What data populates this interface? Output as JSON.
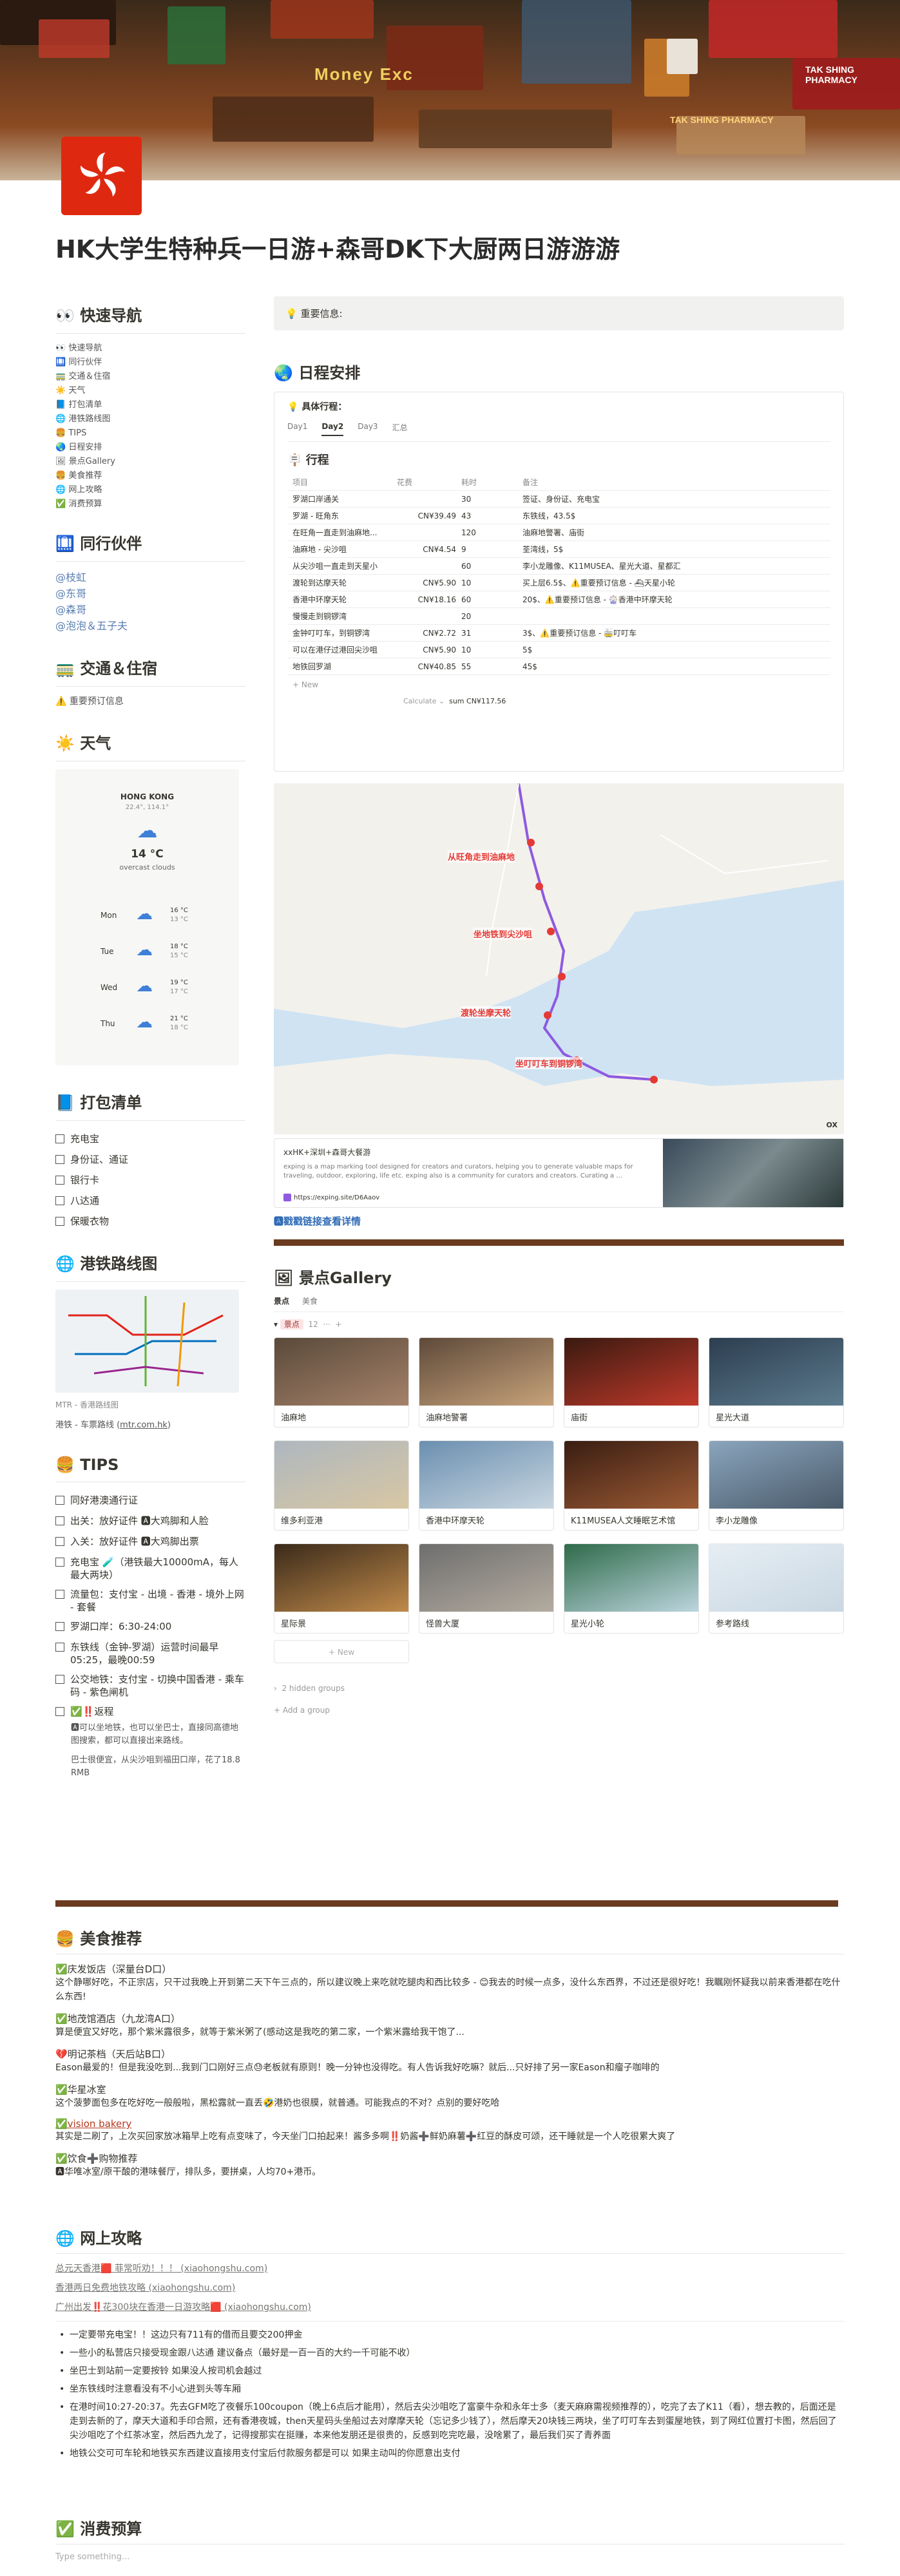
{
  "cover": {
    "signs": [
      "Money Exc",
      "TAK SHING PHARMACY",
      "TAK SHING PHARMACY"
    ]
  },
  "page": {
    "title": "HK大学生特种兵一日游+森哥DK下大厨两日游游游"
  },
  "nav": {
    "title": "快速导航",
    "items": [
      "快速导航",
      "同行伙伴",
      "交通＆住宿",
      "天气",
      "打包清单",
      "港铁路线图",
      "TIPS",
      "日程安排",
      "景点Gallery",
      "美食推荐",
      "网上攻略",
      "消费预算"
    ]
  },
  "companions": {
    "title": "同行伙伴",
    "people": [
      "@枝虹",
      "@东哥",
      "@森哥",
      "@泡泡＆五子夫"
    ]
  },
  "transport": {
    "title": "交通＆住宿",
    "item": "重要预订信息"
  },
  "weather": {
    "title": "天气",
    "city": "HONG KONG",
    "coords": "22.4°, 114.1°",
    "temp": "14 °C",
    "desc": "overcast clouds",
    "days": [
      {
        "day": "Mon",
        "hi": "16 °C",
        "lo": "13 °C"
      },
      {
        "day": "Tue",
        "hi": "18 °C",
        "lo": "15 °C"
      },
      {
        "day": "Wed",
        "hi": "19 °C",
        "lo": "17 °C"
      },
      {
        "day": "Thu",
        "hi": "21 °C",
        "lo": "18 °C"
      }
    ]
  },
  "packing": {
    "title": "打包清单",
    "items": [
      "充电宝",
      "身份证、通证",
      "银行卡",
      "八达通",
      "保暖衣物"
    ]
  },
  "mtr": {
    "title": "港铁路线图",
    "caption": "MTR - 香港路线图",
    "link_prefix": "港铁 - 车票路线 (",
    "link": "mtr.com.hk",
    "link_suffix": ")"
  },
  "tips": {
    "title": "TIPS",
    "items": [
      "同好港澳通行证",
      "出关：放好证件 🅰大鸡脚和人脸",
      "入关：放好证件 🅰大鸡脚出票",
      "充电宝 🧪（港铁最大10000mA，每人最大两块）",
      "流量包：支付宝 - 出境 - 香港 - 境外上网 - 套餐",
      "罗湖口岸：6:30-24:00",
      "东铁线（金钟-罗湖）运营时间最早05:25，最晚00:59",
      "公交地铁：支付宝 - 切换中国香港 - 乘车码 - 紫色闸机",
      "✅‼️返程"
    ],
    "return_lines": [
      "🅰可以坐地铁，也可以坐巴士，直接同高德地图搜索，都可以直接出来路线。",
      "巴士很便宜，从尖沙咀到福田口岸，花了18.8 RMB"
    ]
  },
  "important": {
    "label": "重要信息:"
  },
  "schedule": {
    "title": "日程安排",
    "callout_label": "具体行程：",
    "tabs": [
      "Day1",
      "Day2",
      "Day3",
      "汇总"
    ],
    "db_title": "行程",
    "columns": [
      "项目",
      "花费",
      "耗时",
      "备注"
    ],
    "rows": [
      {
        "item": "罗湖口岸通关",
        "cost": "",
        "time": "30",
        "note": "签证、身份证、充电宝"
      },
      {
        "item": "罗湖 - 旺角东",
        "cost": "CN¥39.49",
        "time": "43",
        "note": "东铁线，43.5$"
      },
      {
        "item": "在旺角一直走到油麻地...",
        "cost": "",
        "time": "120",
        "note": "油麻地警署、庙街"
      },
      {
        "item": "油麻地 - 尖沙咀",
        "cost": "CN¥4.54",
        "time": "9",
        "note": "荃湾线，5$"
      },
      {
        "item": "从尖沙咀一直走到天星小",
        "cost": "",
        "time": "60",
        "note": "李小龙雕像、K11MUSEA、星光大道、星都汇"
      },
      {
        "item": "渡轮到达摩天轮",
        "cost": "CN¥5.90",
        "time": "10",
        "note": "买上层6.5$、⚠️重要预订信息 - ⛴天星小轮"
      },
      {
        "item": "香港中环摩天轮",
        "cost": "CN¥18.16",
        "time": "60",
        "note": "20$、⚠️重要预订信息 - 🎡香港中环摩天轮"
      },
      {
        "item": "慢慢走到铜锣湾",
        "cost": "",
        "time": "20",
        "note": ""
      },
      {
        "item": "金钟叮叮车，到铜锣湾",
        "cost": "CN¥2.72",
        "time": "31",
        "note": "3$、⚠️重要预订信息 - 🚋叮叮车"
      },
      {
        "item": "可以在港仔过港回尖沙咀",
        "cost": "CN¥5.90",
        "time": "10",
        "note": "5$"
      },
      {
        "item": "地铁回罗湖",
        "cost": "CN¥40.85",
        "time": "55",
        "note": "45$"
      }
    ],
    "new_label": "+ New",
    "calc_label": "Calculate ⌄",
    "sum_label": "sum CN¥117.56"
  },
  "map": {
    "labels": [
      "从旺角走到油麻地",
      "坐地铁到尖沙咀",
      "渡轮坐摩天轮",
      "坐叮叮车到铜锣湾"
    ],
    "corner": "OX"
  },
  "bookmark": {
    "title": "xxHK+深圳+森哥大餐游",
    "desc": "exping is a map marking tool designed for creators and curators, helping you to generate valuable maps for traveling, outdoor, exploring, life etc. exping also is a community for curators and creators. Curating a ...",
    "url": "https://exping.site/D6Aaov",
    "detail_link": "🅰戳戳链接查看详情"
  },
  "gallery": {
    "title": "景点Gallery",
    "tabs": [
      "景点",
      "美食"
    ],
    "group_label": "景点",
    "group_count": "12",
    "cards": [
      "油麻地",
      "油麻地警署",
      "庙街",
      "星光大道",
      "维多利亚港",
      "香港中环摩天轮",
      "K11MUSEA人文睡眠艺术馆",
      "李小龙雕像",
      "星际景",
      "怪兽大厦",
      "星光小轮",
      "参考路线"
    ],
    "new_label": "+ New",
    "hidden_groups": "2 hidden groups",
    "add_group": "+ Add a group"
  },
  "food": {
    "title": "美食推荐",
    "entries": [
      {
        "name": "✅庆发饭店（深量台D口）",
        "text": "这个静哪好吃，不正宗店，只干过我晚上开到第二天下午三点的，所以建议晚上来吃就吃腿肉和西比较多 - 😊我去的时候一点多，没什么东西界，不过还是很好吃！我瞩刚怀疑我以前来香港都在吃什么东西!"
      },
      {
        "name": "✅地茂馆酒店（九龙湾A口）",
        "text": "算是便宜又好吃，那个紫米露很多，就等于紫米粥了(感动这是我吃的第二家，一个紫米露给我干饱了..."
      },
      {
        "name": "💔明记茶档（天后站B口）",
        "text": "Eason最爱的！但是我没吃到...我到门口刚好三点😓老板就有原则！晚一分钟也没得吃。有人告诉我好吃嘛？就后...只好排了另一家Eason和瘤子咖啡的"
      },
      {
        "name": "✅华星冰室",
        "text": "这个菠萝面包多在吃好吃一般般啦，黑松露就一直丢🤣港奶也很膜，就普通。可能我点的不对？点别的要好吃哈"
      },
      {
        "name": "✅vision bakery",
        "text": "其实是二刷了，上次买回家放冰箱早上吃有点变味了，今天坐门口拍起来！酱多多啊‼️奶酱➕鲜奶麻薯➕红豆的酥皮可颂，还干睡就是一个人吃很累大爽了"
      },
      {
        "name": "✅饮食➕购物推荐",
        "text": "🅰华唯冰室/原干酸的港味餐厅，排队多，要拼桌，人均70+港币。"
      }
    ]
  },
  "guides": {
    "title": "网上攻略",
    "links": [
      "总元天香港🟥 菲常听劝！！！ (xiaohongshu.com)",
      "香港两日免费地铁攻略 (xiaohongshu.com)",
      "广州出发‼️花300块在香港一日游攻略🟥 (xiaohongshu.com)"
    ],
    "bullets": [
      "一定要带充电宝！！这边只有711有的借而且要交200押金",
      "一些小的私营店只接受现金跟八达通 建议备点（最好是一百一百的大约一千可能不收）",
      "坐巴士到站前一定要按铃 如果没人按司机会越过",
      "坐东铁线时注意看没有不小心进到头等车厢",
      "在港时间10:27-20:37。先去GFM吃了夜餐乐100coupon（晚上6点后才能用），然后去尖沙咀吃了富豪牛杂和永年士多（麦天麻麻需视频推荐的），吃完了去了K11（看），想去教的，后面还是走到去新的了，摩天大道和手印合照，还有香港夜城，then天星码头坐船过去对摩摩天轮（忘记多少钱了），然后摩天20块钱三两块，坐了叮叮车去到蛋屋地铁，到了网红位置打卡图，然后回了尖沙咀吃了个红茶冰室，然后西九龙了，记得搜那实在挺赚，本来他发朋还是很贵的，反感到吃完吃最，没啥累了，最后我们买了青养面",
      "地铁公交可可车轮和地铁买东西建议直接用支付宝后付款服务都是可以 如果主动叫的你愿意出支付"
    ]
  },
  "budget": {
    "title": "消费预算",
    "placeholder": "Type something..."
  }
}
